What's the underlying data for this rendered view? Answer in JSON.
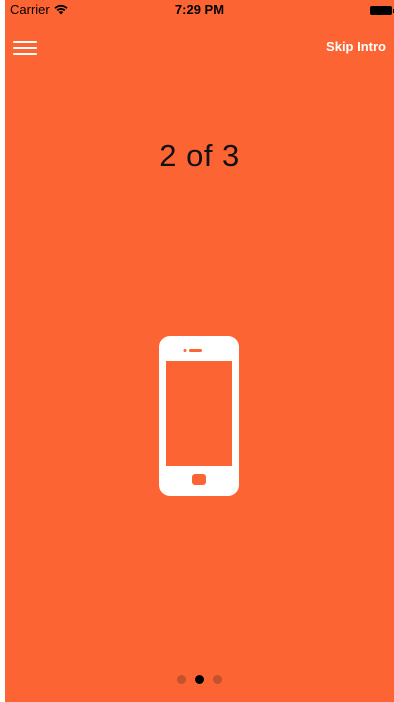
{
  "colors": {
    "background": "#fd6434",
    "text_dark": "#111111",
    "text_light": "#ffffff"
  },
  "status_bar": {
    "carrier": "Carrier",
    "time": "7:29 PM",
    "wifi_icon": "wifi-icon",
    "battery_icon": "battery-icon"
  },
  "header": {
    "menu_icon": "hamburger-menu-icon",
    "skip_label": "Skip Intro"
  },
  "main": {
    "step_title": "2 of 3",
    "illustration_icon": "smartphone-icon"
  },
  "pagination": {
    "total": 3,
    "current": 2
  }
}
